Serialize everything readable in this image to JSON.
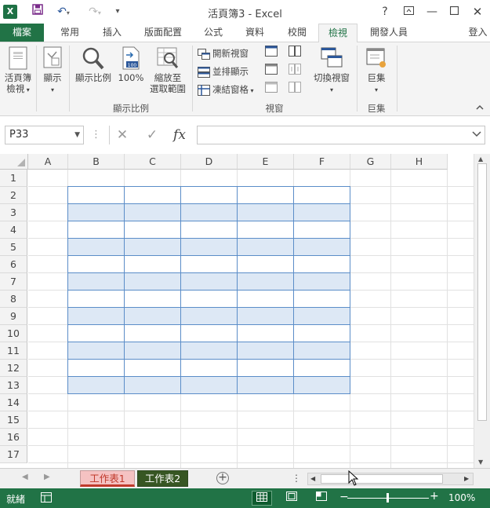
{
  "window": {
    "title": "活頁簿3 - Excel",
    "app_icon": "X",
    "help": "?",
    "signin": "登入"
  },
  "tabs": [
    {
      "label": "檔案"
    },
    {
      "label": "常用"
    },
    {
      "label": "插入"
    },
    {
      "label": "版面配置"
    },
    {
      "label": "公式"
    },
    {
      "label": "資料"
    },
    {
      "label": "校閱"
    },
    {
      "label": "檢視"
    },
    {
      "label": "開發人員"
    }
  ],
  "active_tab": "檢視",
  "ribbon": {
    "workbook_views_line1": "活頁簿",
    "workbook_views_line2": "檢視",
    "show": "顯示",
    "zoom": "顯示比例",
    "zoom100": "100%",
    "zoom_selection_line1": "縮放至",
    "zoom_selection_line2": "選取範圍",
    "zoom_group": "顯示比例",
    "new_window": "開新視窗",
    "arrange_all": "並排顯示",
    "freeze_panes": "凍結窗格",
    "switch_windows": "切換視窗",
    "window_group": "視窗",
    "macros": "巨集",
    "macros_group": "巨集"
  },
  "formula_bar": {
    "name_box": "P33",
    "fx": "fx",
    "value": ""
  },
  "grid": {
    "columns": [
      "A",
      "B",
      "C",
      "D",
      "E",
      "F",
      "G",
      "H"
    ],
    "rows": [
      "1",
      "2",
      "3",
      "4",
      "5",
      "6",
      "7",
      "8",
      "9",
      "10",
      "11",
      "12",
      "13",
      "14",
      "15",
      "16",
      "17"
    ],
    "table_range": "B2:F13"
  },
  "sheets": [
    {
      "name": "工作表1",
      "color": "#c0392b"
    },
    {
      "name": "工作表2",
      "color": "#375623"
    }
  ],
  "status": {
    "ready": "就緒",
    "zoom": "100%"
  },
  "colors": {
    "accent": "#217346",
    "table_band": "#dde8f5",
    "table_border": "#5b8dc8"
  }
}
